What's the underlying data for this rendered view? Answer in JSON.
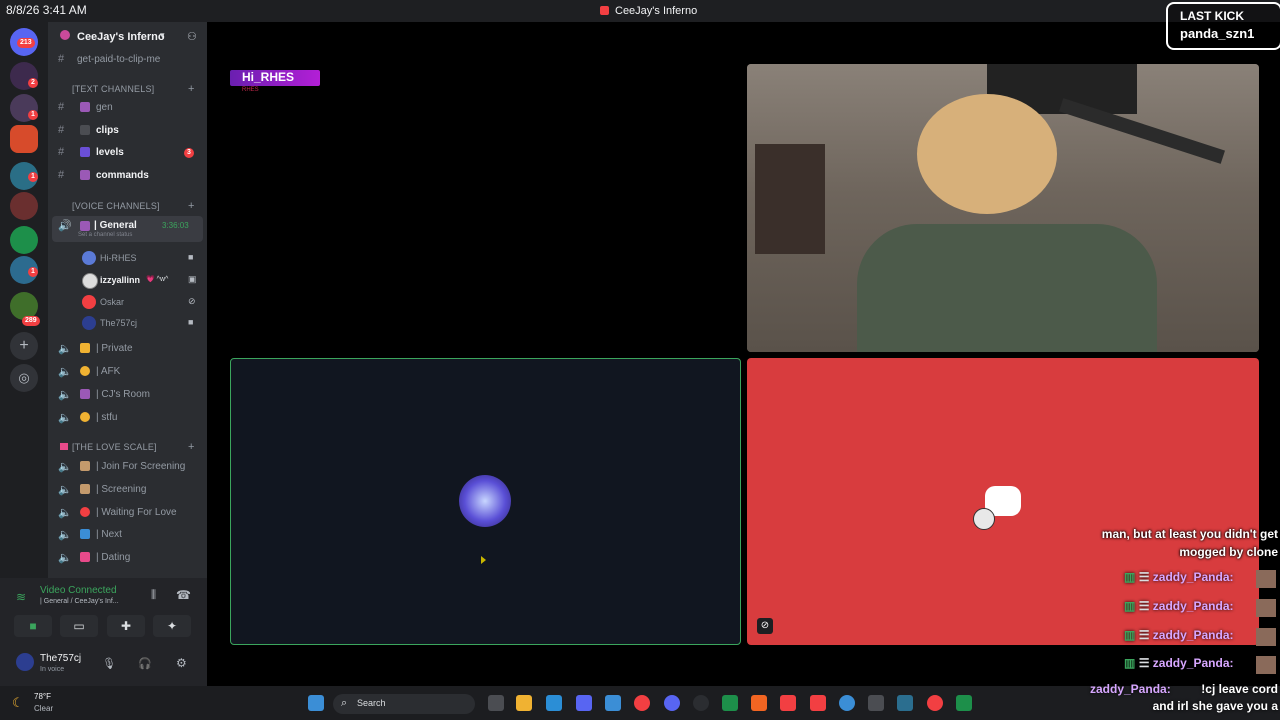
{
  "clock": "8/8/26 3:41 AM",
  "window_title": "CeeJay's Inferno",
  "rail": {
    "badges": [
      "213",
      "2",
      "1",
      "1",
      "1",
      "289"
    ]
  },
  "server": {
    "name": "CeeJay's Inferno",
    "top_channel": "get-paid-to-clip-me",
    "text_category": "[TEXT CHANNELS]",
    "text_channels": [
      {
        "name": "gen",
        "prefix": "|"
      },
      {
        "name": "clips",
        "prefix": "|"
      },
      {
        "name": "levels",
        "prefix": "|",
        "badge": "3"
      },
      {
        "name": "commands",
        "prefix": "|"
      }
    ],
    "voice_category": "[VOICE CHANNELS]",
    "general": {
      "name": "| General",
      "timer": "3:36:03",
      "status": "Set a channel status"
    },
    "voice_users": [
      {
        "name": "Hi-RHES"
      },
      {
        "name": "izzyallinn",
        "extra": "💗 ^w^"
      },
      {
        "name": "Oskar"
      },
      {
        "name": "The757cj"
      }
    ],
    "voice_channels": [
      "| Private",
      "| AFK",
      "| CJ's Room",
      "| stfu"
    ],
    "love_category": "[THE LOVE SCALE]",
    "love_channels": [
      "| Join For Screening",
      "| Screening",
      "| Waiting For Love",
      "| Next",
      "| Dating"
    ]
  },
  "voice_panel": {
    "status": "Video Connected",
    "location": "| General / CeeJay's Inf...",
    "user": "The757cj",
    "user_status": "In voice"
  },
  "tiles": {
    "a_name": "Hi_RHES",
    "a_sub": "RHES"
  },
  "overlay": {
    "last_kick_label": "LAST KICK",
    "last_kick_name": "panda_szn1",
    "chat_line1": "man, but at least you didn't get",
    "chat_line2": "mogged by clone",
    "chat_user": "zaddy_Panda:",
    "chat_last_msg1": "!cj leave cord",
    "chat_last_msg2": "and irl she gave you a"
  },
  "taskbar": {
    "weather_temp": "78°F",
    "weather_desc": "Clear",
    "search": "Search"
  },
  "colors": {
    "accent_green": "#3ba55d",
    "discord_red": "#d83c3e",
    "badge_red": "#f23f42"
  }
}
